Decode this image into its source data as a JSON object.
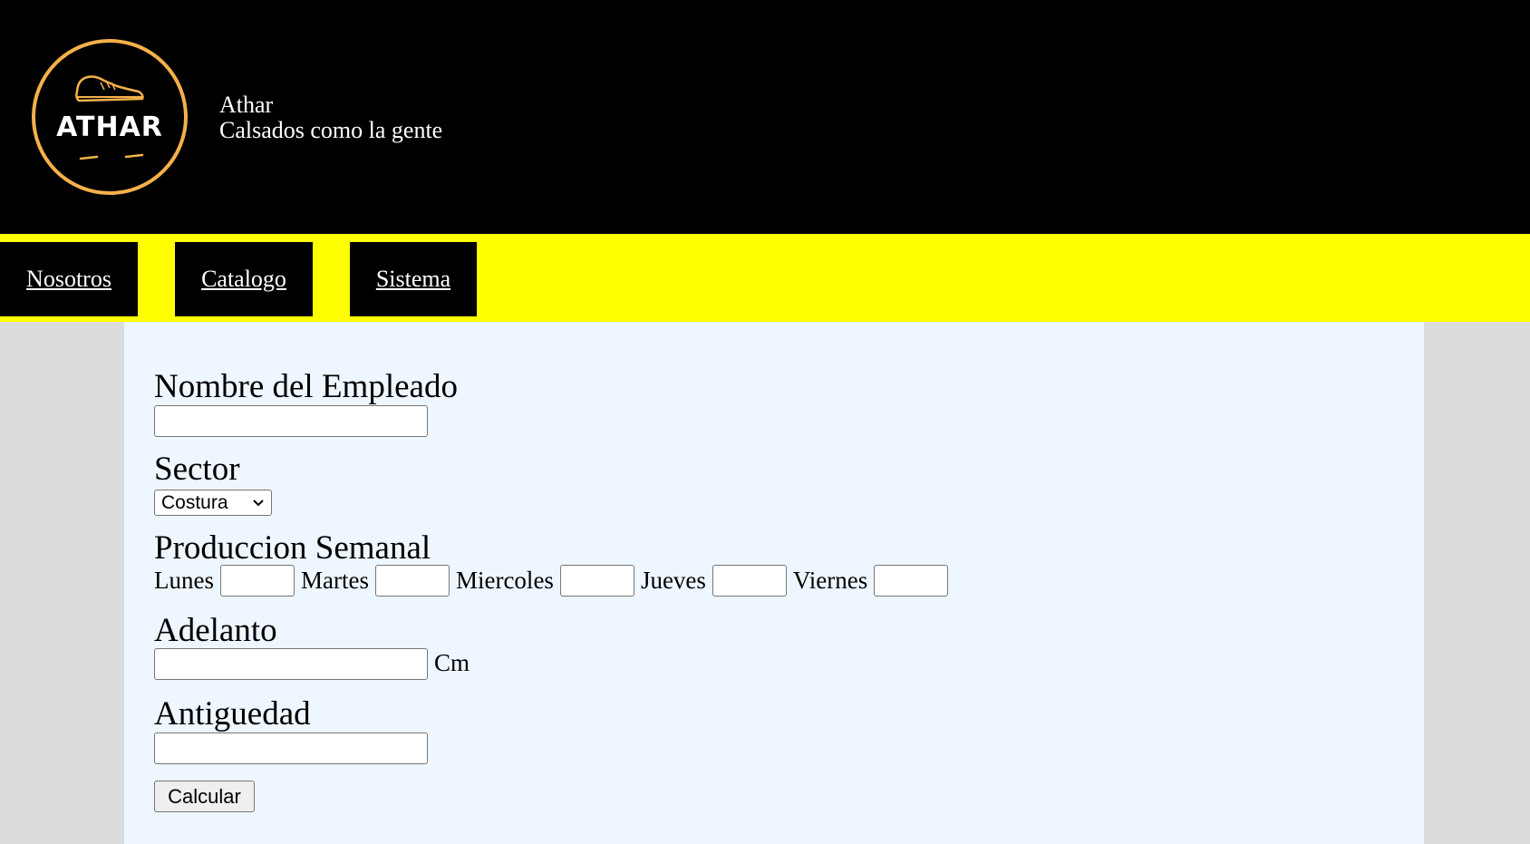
{
  "header": {
    "logo_text": "ATHAR",
    "brand_name": "Athar",
    "tagline": "Calsados como la gente",
    "logo_icon": "shoe-icon",
    "logo_ring_color": "#f4b14a"
  },
  "nav": {
    "items": [
      {
        "label": "Nosotros"
      },
      {
        "label": "Catalogo"
      },
      {
        "label": "Sistema"
      }
    ],
    "background": "#ffff00"
  },
  "form": {
    "nombre_label": "Nombre del Empleado",
    "nombre_value": "",
    "sector_label": "Sector",
    "sector_selected": "Costura",
    "produccion_label": "Produccion Semanal",
    "days": [
      {
        "label": "Lunes",
        "value": ""
      },
      {
        "label": "Martes",
        "value": ""
      },
      {
        "label": "Miercoles",
        "value": ""
      },
      {
        "label": "Jueves",
        "value": ""
      },
      {
        "label": "Viernes",
        "value": ""
      }
    ],
    "adelanto_label": "Adelanto",
    "adelanto_value": "",
    "adelanto_unit": "Cm",
    "antiguedad_label": "Antiguedad",
    "antiguedad_value": "",
    "submit_label": "Calcular"
  }
}
